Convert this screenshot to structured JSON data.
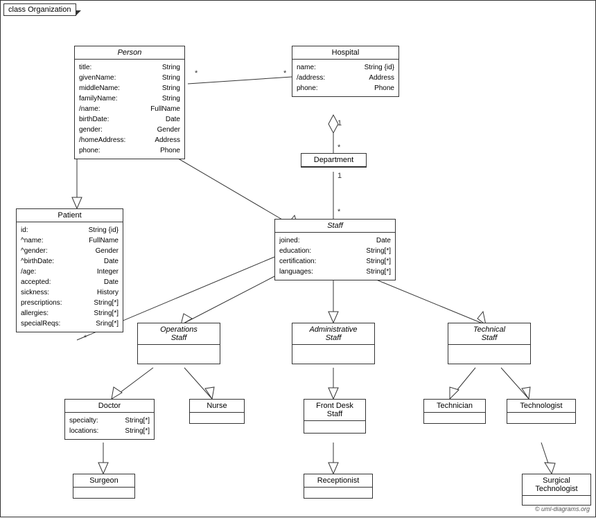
{
  "diagram": {
    "title": "class Organization",
    "copyright": "© uml-diagrams.org",
    "classes": {
      "person": {
        "name": "Person",
        "italic": true,
        "attrs": [
          {
            "name": "title:",
            "type": "String"
          },
          {
            "name": "givenName:",
            "type": "String"
          },
          {
            "name": "middleName:",
            "type": "String"
          },
          {
            "name": "familyName:",
            "type": "String"
          },
          {
            "name": "/name:",
            "type": "FullName"
          },
          {
            "name": "birthDate:",
            "type": "Date"
          },
          {
            "name": "gender:",
            "type": "Gender"
          },
          {
            "name": "/homeAddress:",
            "type": "Address"
          },
          {
            "name": "phone:",
            "type": "Phone"
          }
        ]
      },
      "hospital": {
        "name": "Hospital",
        "attrs": [
          {
            "name": "name:",
            "type": "String {id}"
          },
          {
            "name": "/address:",
            "type": "Address"
          },
          {
            "name": "phone:",
            "type": "Phone"
          }
        ]
      },
      "department": {
        "name": "Department",
        "attrs": []
      },
      "staff": {
        "name": "Staff",
        "italic": true,
        "attrs": [
          {
            "name": "joined:",
            "type": "Date"
          },
          {
            "name": "education:",
            "type": "String[*]"
          },
          {
            "name": "certification:",
            "type": "String[*]"
          },
          {
            "name": "languages:",
            "type": "String[*]"
          }
        ]
      },
      "patient": {
        "name": "Patient",
        "attrs": [
          {
            "name": "id:",
            "type": "String {id}"
          },
          {
            "name": "^name:",
            "type": "FullName"
          },
          {
            "name": "^gender:",
            "type": "Gender"
          },
          {
            "name": "^birthDate:",
            "type": "Date"
          },
          {
            "name": "/age:",
            "type": "Integer"
          },
          {
            "name": "accepted:",
            "type": "Date"
          },
          {
            "name": "sickness:",
            "type": "History"
          },
          {
            "name": "prescriptions:",
            "type": "String[*]"
          },
          {
            "name": "allergies:",
            "type": "String[*]"
          },
          {
            "name": "specialReqs:",
            "type": "Sring[*]"
          }
        ]
      },
      "operations_staff": {
        "name": "Operations Staff",
        "italic": true,
        "attrs": []
      },
      "administrative_staff": {
        "name": "Administrative Staff",
        "italic": true,
        "attrs": []
      },
      "technical_staff": {
        "name": "Technical Staff",
        "italic": true,
        "attrs": []
      },
      "doctor": {
        "name": "Doctor",
        "attrs": [
          {
            "name": "specialty:",
            "type": "String[*]"
          },
          {
            "name": "locations:",
            "type": "String[*]"
          }
        ]
      },
      "nurse": {
        "name": "Nurse",
        "attrs": []
      },
      "front_desk_staff": {
        "name": "Front Desk Staff",
        "attrs": []
      },
      "technician": {
        "name": "Technician",
        "attrs": []
      },
      "technologist": {
        "name": "Technologist",
        "attrs": []
      },
      "surgeon": {
        "name": "Surgeon",
        "attrs": []
      },
      "receptionist": {
        "name": "Receptionist",
        "attrs": []
      },
      "surgical_technologist": {
        "name": "Surgical Technologist",
        "attrs": []
      }
    }
  }
}
